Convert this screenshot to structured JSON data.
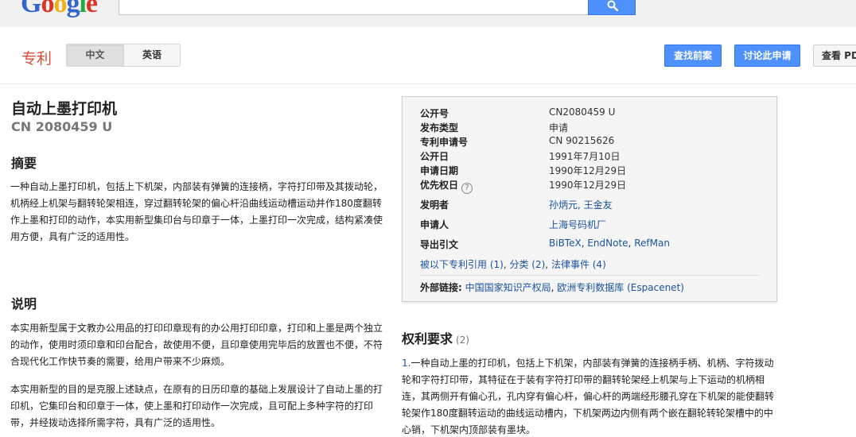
{
  "search": {
    "logo_letters": [
      {
        "ch": "G",
        "color": "blue"
      },
      {
        "ch": "o",
        "color": "red"
      },
      {
        "ch": "o",
        "color": "yellow"
      },
      {
        "ch": "g",
        "color": "blue"
      },
      {
        "ch": "l",
        "color": "green"
      },
      {
        "ch": "e",
        "color": "red"
      }
    ],
    "query": "",
    "button_icon": "search-icon"
  },
  "header": {
    "section_label": "专利",
    "lang_active": "中文",
    "lang_inactive": "英语",
    "prior_art_button": "查找前案",
    "discuss_button": "讨论此申请",
    "view_pdf_button": "查看 PDF"
  },
  "patent": {
    "title": "自动上墨打印机",
    "pub_number": "CN 2080459 U"
  },
  "abstract": {
    "heading": "摘要",
    "text": "一种自动上墨打印机，包括上下机架，内部装有弹簧的连接柄，字符打印带及其拨动轮，机柄经上机架与翻转轮架相连，穿过翻转轮架的偏心杆沿曲线运动槽运动并作180度翻转作上墨和打印的动作，本实用新型集印台与印章于一体，上墨打印一次完成，结构紧凑使用方便，具有广泛的适用性。"
  },
  "description": {
    "heading": "说明",
    "paragraphs": [
      "本实用新型属于文教办公用品的打印印章现有的办公用打印印章，打印和上墨是两个独立的动作，使用时须印章和印台配合，故使用不便，且印章使用完毕后的放置也不便，不符合现代化工作快节奏的需要，给用户带来不少麻烦。",
      "本实用新型的目的是克服上述缺点，在原有的日历印章的基础上发展设计了自动上墨的打印机，它集印台和印章于一体，使上墨和打印动作一次完成，且可配上多种字符的打印带，并经拨动选择所需字符，具有广泛的适用性。"
    ]
  },
  "info": {
    "rows": [
      {
        "label": "公开号",
        "value": "CN2080459 U"
      },
      {
        "label": "发布类型",
        "value": "申请"
      },
      {
        "label": "专利申请号",
        "value": "CN 90215626"
      },
      {
        "label": "公开日",
        "value": "1991年7月10日"
      },
      {
        "label": "申请日期",
        "value": "1990年12月29日"
      },
      {
        "label": "优先权日",
        "value": "1990年12月29日"
      }
    ],
    "help_icon": "question-circle-icon",
    "inventor_label": "发明者",
    "inventor_value": "孙炳元, 王金友",
    "applicant_label": "申请人",
    "applicant_value": "上海号码机厂",
    "export_label": "导出引文",
    "export_links": [
      "BiBTeX",
      "EndNote",
      "RefMan"
    ],
    "cited_by": "被以下专利引用 (1)",
    "classification": "分类 (2)",
    "legal_events": "法律事件 (4)",
    "external_label": "外部链接:",
    "external_links": [
      "中国国家知识产权局",
      "欧洲专利数据库 (Espacenet)"
    ]
  },
  "claims": {
    "heading": "权利要求",
    "count": "(2)",
    "number": "1.",
    "text": "一种自动上墨的打印机，包括上下机架，内部装有弹簧的连接柄手柄、机柄、字符拨动轮和字符打印带，其特征在于装有字符打印带的翻转轮架经上机架与上下运动的机柄相连，其两侧开有偏心孔，孔内穿有偏心杆，偏心杆的两端经形腰孔穿在下机架的能使翻转轮架作180度翻转运动的曲线运动槽内，下机架两边内侧有两个嵌在翻轮转轮架槽中的中心销，下机架内顶部装有墨块。"
  }
}
